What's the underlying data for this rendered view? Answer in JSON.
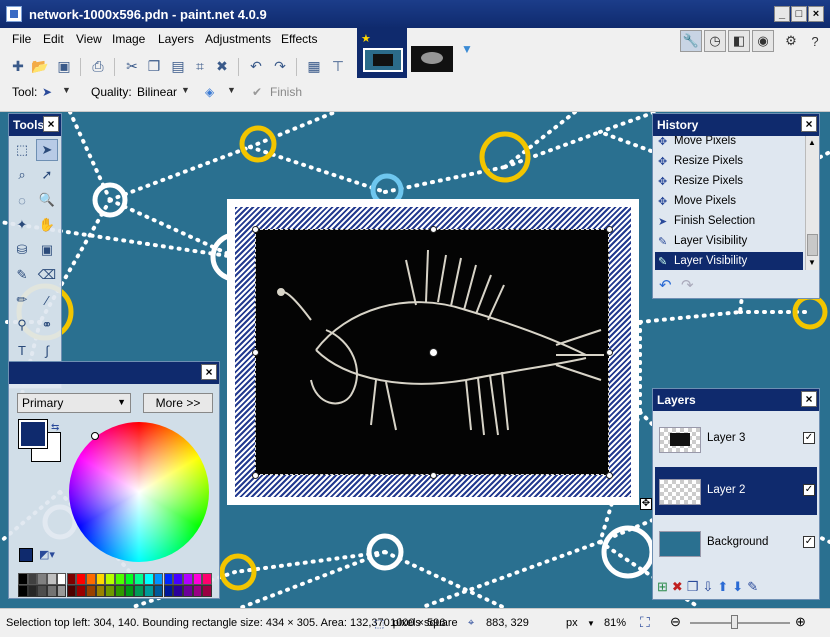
{
  "window": {
    "title": "network-1000x596.pdn - paint.net 4.0.9"
  },
  "menu": [
    {
      "label": "File"
    },
    {
      "label": "Edit"
    },
    {
      "label": "View"
    },
    {
      "label": "Image"
    },
    {
      "label": "Layers"
    },
    {
      "label": "Adjustments"
    },
    {
      "label": "Effects"
    }
  ],
  "toolbar2": {
    "tool_label": "Tool:",
    "quality_label": "Quality:",
    "quality_value": "Bilinear",
    "finish_label": "Finish"
  },
  "tools_panel": {
    "title": "Tools"
  },
  "history_panel": {
    "title": "History",
    "items": [
      {
        "label": "Move Pixels"
      },
      {
        "label": "Resize Pixels"
      },
      {
        "label": "Resize Pixels"
      },
      {
        "label": "Move Pixels"
      },
      {
        "label": "Finish Selection"
      },
      {
        "label": "Layer Visibility"
      },
      {
        "label": "Layer Visibility"
      }
    ],
    "selected_index": 6
  },
  "colors_panel": {
    "primary_label": "Primary",
    "more_label": "More >>",
    "primary_color": "#0f2a6d"
  },
  "layers_panel": {
    "title": "Layers",
    "layers": [
      {
        "name": "Layer 3",
        "visible": true
      },
      {
        "name": "Layer 2",
        "visible": true
      },
      {
        "name": "Background",
        "visible": true
      }
    ],
    "selected_index": 1
  },
  "status": {
    "selection_info": "Selection top left: 304, 140. Bounding rectangle size: 434 × 305. Area: 132,370 pixels square",
    "image_size": "1000 × 596",
    "cursor_pos": "883, 329",
    "units": "px",
    "zoom": "81%"
  },
  "palette": [
    "#000000",
    "#404040",
    "#808080",
    "#c0c0c0",
    "#ffffff",
    "#7f0000",
    "#ff0000",
    "#ff6a00",
    "#ffd800",
    "#b6ff00",
    "#4cff00",
    "#00ff21",
    "#00ff90",
    "#00ffff",
    "#0094ff",
    "#0026ff",
    "#4800ff",
    "#b200ff",
    "#ff00dc",
    "#ff006e"
  ]
}
